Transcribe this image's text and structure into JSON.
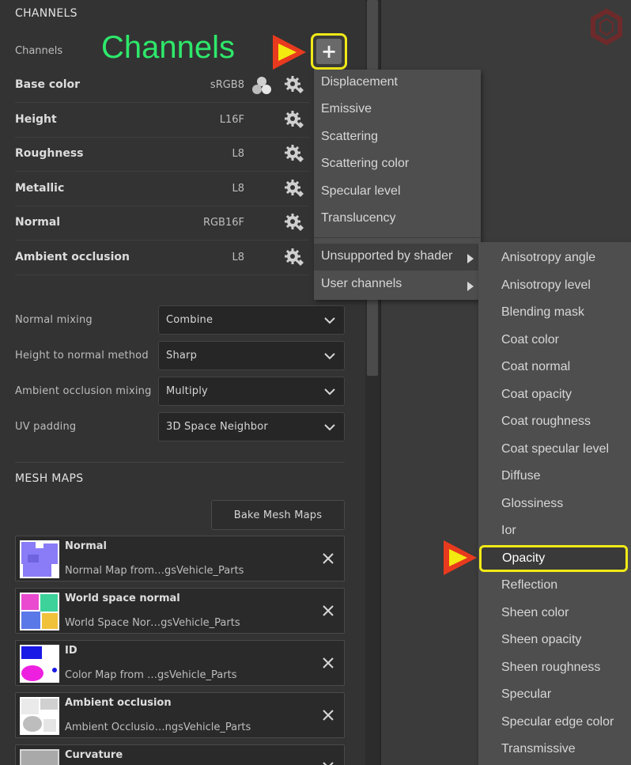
{
  "panel": {
    "channels_section_title": "CHANNELS",
    "channels_label": "Channels",
    "add_button_label": "+",
    "channels": [
      {
        "name": "Base color",
        "format": "sRGB8",
        "has_color_icon": true
      },
      {
        "name": "Height",
        "format": "L16F"
      },
      {
        "name": "Roughness",
        "format": "L8"
      },
      {
        "name": "Metallic",
        "format": "L8"
      },
      {
        "name": "Normal",
        "format": "RGB16F"
      },
      {
        "name": "Ambient occlusion",
        "format": "L8"
      }
    ],
    "settings": [
      {
        "label": "Normal mixing",
        "value": "Combine"
      },
      {
        "label": "Height to normal method",
        "value": "Sharp"
      },
      {
        "label": "Ambient occlusion mixing",
        "value": "Multiply"
      },
      {
        "label": "UV padding",
        "value": "3D Space Neighbor"
      }
    ],
    "mesh_maps_title": "MESH MAPS",
    "bake_button": "Bake Mesh Maps",
    "mesh_maps": [
      {
        "name": "Normal",
        "desc": "Normal Map from…gsVehicle_Parts"
      },
      {
        "name": "World space normal",
        "desc": "World Space Nor…gsVehicle_Parts"
      },
      {
        "name": "ID",
        "desc": "Color Map from …gsVehicle_Parts"
      },
      {
        "name": "Ambient occlusion",
        "desc": "Ambient Occlusio…ngsVehicle_Parts"
      },
      {
        "name": "Curvature",
        "desc": ""
      }
    ]
  },
  "annotation": {
    "label": "Channels",
    "color": "#2ee86b",
    "highlight": "#f1ea17"
  },
  "menu": {
    "items": [
      {
        "label": "Displacement"
      },
      {
        "label": "Emissive"
      },
      {
        "label": "Scattering"
      },
      {
        "label": "Scattering color"
      },
      {
        "label": "Specular level"
      },
      {
        "label": "Translucency"
      },
      {
        "label": "Unsupported by shader",
        "submenu": true,
        "highlighted": true
      },
      {
        "label": "User channels",
        "submenu": true
      }
    ]
  },
  "submenu": {
    "items": [
      {
        "label": "Anisotropy angle"
      },
      {
        "label": "Anisotropy level"
      },
      {
        "label": "Blending mask"
      },
      {
        "label": "Coat color"
      },
      {
        "label": "Coat normal"
      },
      {
        "label": "Coat opacity"
      },
      {
        "label": "Coat roughness"
      },
      {
        "label": "Coat specular level"
      },
      {
        "label": "Diffuse"
      },
      {
        "label": "Glossiness"
      },
      {
        "label": "Ior"
      },
      {
        "label": "Opacity",
        "selected": true
      },
      {
        "label": "Reflection"
      },
      {
        "label": "Sheen color"
      },
      {
        "label": "Sheen opacity"
      },
      {
        "label": "Sheen roughness"
      },
      {
        "label": "Specular"
      },
      {
        "label": "Specular edge color"
      },
      {
        "label": "Transmissive"
      }
    ]
  },
  "icons": {
    "gear": "gear-icon",
    "chevron": "chevron-down-icon",
    "close": "close-icon",
    "submenu_arrow": "chevron-right-icon",
    "logo": "app-logo-icon"
  }
}
